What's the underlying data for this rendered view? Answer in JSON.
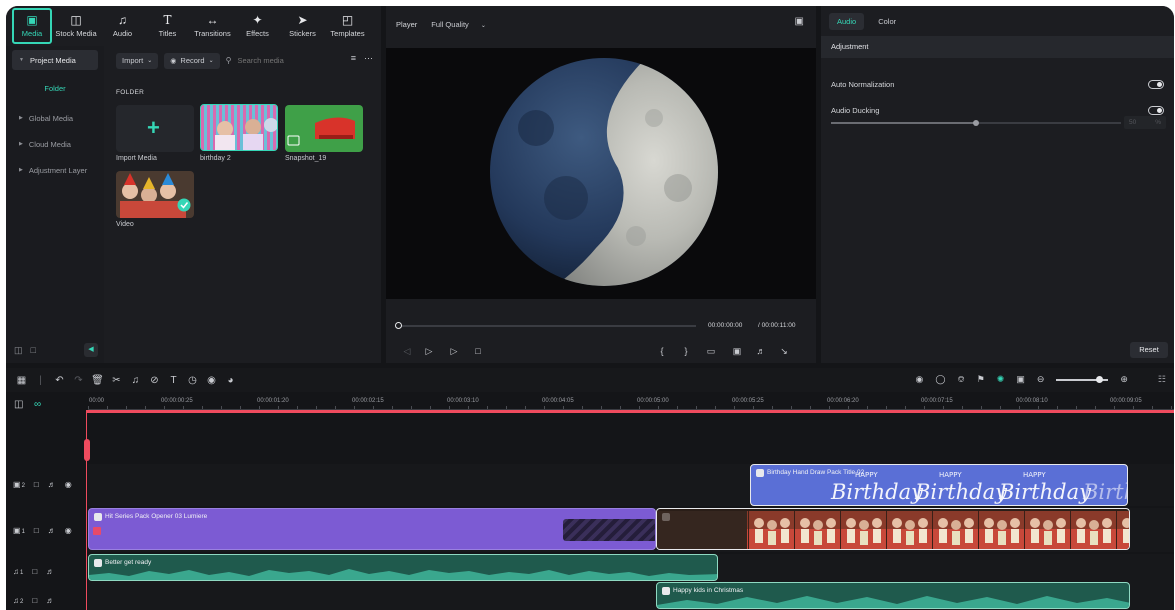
{
  "toolbar": {
    "items": [
      {
        "label": "Media",
        "icon": "media-icon"
      },
      {
        "label": "Stock Media",
        "icon": "stock-media-icon"
      },
      {
        "label": "Audio",
        "icon": "music-note-icon"
      },
      {
        "label": "Titles",
        "icon": "text-icon"
      },
      {
        "label": "Transitions",
        "icon": "transitions-icon"
      },
      {
        "label": "Effects",
        "icon": "effects-icon"
      },
      {
        "label": "Stickers",
        "icon": "stickers-icon"
      },
      {
        "label": "Templates",
        "icon": "templates-icon"
      }
    ],
    "active": "Media"
  },
  "media_sidebar": {
    "project_media": "Project Media",
    "folder": "Folder",
    "items": [
      "Global Media",
      "Cloud Media",
      "Adjustment Layer"
    ]
  },
  "media_content": {
    "import_label": "Import",
    "record_label": "Record",
    "search_placeholder": "Search media",
    "folder_heading": "FOLDER",
    "items": [
      {
        "label": "Import Media"
      },
      {
        "label": "birthday 2"
      },
      {
        "label": "Snapshot_19"
      },
      {
        "label": "Video"
      }
    ]
  },
  "player": {
    "tab_label": "Player",
    "quality": "Full Quality",
    "current_time": "00:00:00:00",
    "total_time": "/ 00:00:11:00"
  },
  "properties": {
    "tabs": [
      "Audio",
      "Color"
    ],
    "active_tab": "Audio",
    "section": "Adjustment",
    "auto_normalization": "Auto Normalization",
    "audio_ducking": "Audio Ducking",
    "ducking_value": "50",
    "ducking_unit": "%",
    "reset_label": "Reset"
  },
  "ruler": {
    "ticks": [
      "00:00",
      "00:00:00:25",
      "00:00:01:20",
      "00:00:02:15",
      "00:00:03:10",
      "00:00:04:05",
      "00:00:05:00",
      "00:00:05:25",
      "00:00:06:20",
      "00:00:07:15",
      "00:00:08:10",
      "00:00:09:05"
    ]
  },
  "tracks": {
    "video2_num": "2",
    "video1_num": "1",
    "audio1_num": "1",
    "audio2_num": "2"
  },
  "clips": {
    "title_clip": "Birthday Hand Draw Pack Title 02",
    "title_text": "Birthday",
    "happy": "HAPPY",
    "opener_clip": "Hit Series Pack Opener 03 Lumiere",
    "audio1_clip": "Better get ready",
    "audio2_clip": "Happy kids in Christmas"
  },
  "colors": {
    "accent": "#35d6b6",
    "playhead": "#ef4b5e",
    "title_clip": "#5a6fd6",
    "opener_clip": "#7c5bd3",
    "audio_clip": "#1f5a4d"
  }
}
